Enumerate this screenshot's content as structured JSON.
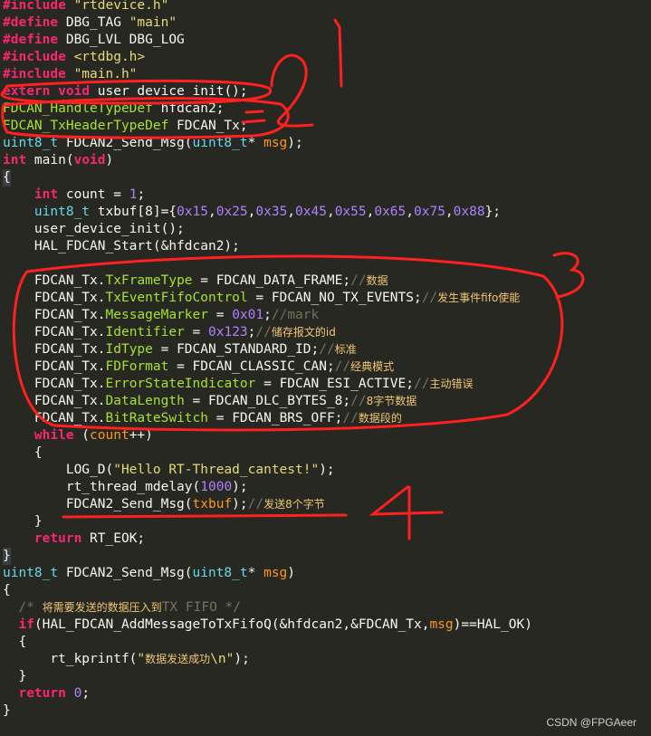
{
  "code_lines": [
    [
      [
        "pp",
        "#include"
      ],
      [
        "pl",
        " "
      ],
      [
        "str",
        "\"rtdevice.h\""
      ]
    ],
    [
      [
        "pp",
        "#define"
      ],
      [
        "pl",
        " DBG_TAG "
      ],
      [
        "str",
        "\"main\""
      ]
    ],
    [
      [
        "pp",
        "#define"
      ],
      [
        "pl",
        " DBG_LVL DBG_LOG"
      ]
    ],
    [
      [
        "pp",
        "#include"
      ],
      [
        "pl",
        " "
      ],
      [
        "str",
        "<rtdbg.h>"
      ]
    ],
    [
      [
        "pp",
        "#include"
      ],
      [
        "pl",
        " "
      ],
      [
        "str",
        "\"main.h\""
      ]
    ],
    [
      [
        "kwb",
        "extern"
      ],
      [
        "pl",
        " "
      ],
      [
        "kwb",
        "void"
      ],
      [
        "pl",
        " user_device_init();"
      ]
    ],
    [
      [
        "typ2",
        "FDCAN_HandleTypeDef"
      ],
      [
        "pl",
        " hfdcan2;"
      ]
    ],
    [
      [
        "typ2",
        "FDCAN_TxHeaderTypeDef"
      ],
      [
        "pl",
        " FDCAN_Tx;"
      ]
    ],
    [
      [
        "type",
        "uint8_t"
      ],
      [
        "pl",
        " FDCAN2_Send_Msg("
      ],
      [
        "type",
        "uint8_t"
      ],
      [
        "pl",
        "* "
      ],
      [
        "var",
        "msg"
      ],
      [
        "pl",
        ");"
      ]
    ],
    [
      [
        "kwb",
        "int"
      ],
      [
        "pl",
        " main("
      ],
      [
        "kwb",
        "void"
      ],
      [
        "pl",
        ")"
      ]
    ],
    [
      [
        "pl",
        "{"
      ]
    ],
    [
      [
        "pl",
        "    "
      ],
      [
        "kwb",
        "int"
      ],
      [
        "pl",
        " count = "
      ],
      [
        "num",
        "1"
      ],
      [
        "pl",
        ";"
      ]
    ],
    [
      [
        "pl",
        "    "
      ],
      [
        "type",
        "uint8_t"
      ],
      [
        "pl",
        " txbuf[8]={"
      ],
      [
        "num",
        "0x15"
      ],
      [
        "pl",
        ","
      ],
      [
        "num",
        "0x25"
      ],
      [
        "pl",
        ","
      ],
      [
        "num",
        "0x35"
      ],
      [
        "pl",
        ","
      ],
      [
        "num",
        "0x45"
      ],
      [
        "pl",
        ","
      ],
      [
        "num",
        "0x55"
      ],
      [
        "pl",
        ","
      ],
      [
        "num",
        "0x65"
      ],
      [
        "pl",
        ","
      ],
      [
        "num",
        "0x75"
      ],
      [
        "pl",
        ","
      ],
      [
        "num",
        "0x88"
      ],
      [
        "pl",
        "};"
      ]
    ],
    [
      [
        "pl",
        "    user_device_init();"
      ]
    ],
    [
      [
        "pl",
        "    HAL_FDCAN_Start(&hfdcan2);"
      ]
    ],
    [
      [
        "pl",
        ""
      ]
    ],
    [
      [
        "pl",
        "    FDCAN_Tx."
      ],
      [
        "fld",
        "TxFrameType"
      ],
      [
        "pl",
        " = FDCAN_DATA_FRAME;"
      ],
      [
        "cm",
        "//"
      ],
      [
        "cmz",
        "数据"
      ]
    ],
    [
      [
        "pl",
        "    FDCAN_Tx."
      ],
      [
        "fld",
        "TxEventFifoControl"
      ],
      [
        "pl",
        " = FDCAN_NO_TX_EVENTS;"
      ],
      [
        "cm",
        "//"
      ],
      [
        "cmz",
        "发生事件fifo使能"
      ]
    ],
    [
      [
        "pl",
        "    FDCAN_Tx."
      ],
      [
        "fld",
        "MessageMarker"
      ],
      [
        "pl",
        " = "
      ],
      [
        "num",
        "0x01"
      ],
      [
        "pl",
        ";"
      ],
      [
        "cm",
        "//mark"
      ]
    ],
    [
      [
        "pl",
        "    FDCAN_Tx."
      ],
      [
        "fld",
        "Identifier"
      ],
      [
        "pl",
        " = "
      ],
      [
        "num",
        "0x123"
      ],
      [
        "pl",
        ";"
      ],
      [
        "cm",
        "//"
      ],
      [
        "cmz",
        "储存报文的id"
      ]
    ],
    [
      [
        "pl",
        "    FDCAN_Tx."
      ],
      [
        "fld",
        "IdType"
      ],
      [
        "pl",
        " = FDCAN_STANDARD_ID;"
      ],
      [
        "cm",
        "//"
      ],
      [
        "cmz",
        "标准"
      ]
    ],
    [
      [
        "pl",
        "    FDCAN_Tx."
      ],
      [
        "fld",
        "FDFormat"
      ],
      [
        "pl",
        " = FDCAN_CLASSIC_CAN;"
      ],
      [
        "cm",
        "//"
      ],
      [
        "cmz",
        "经典模式"
      ]
    ],
    [
      [
        "pl",
        "    FDCAN_Tx."
      ],
      [
        "fld",
        "ErrorStateIndicator"
      ],
      [
        "pl",
        " = FDCAN_ESI_ACTIVE;"
      ],
      [
        "cm",
        "//"
      ],
      [
        "cmz",
        "主动错误"
      ]
    ],
    [
      [
        "pl",
        "    FDCAN_Tx."
      ],
      [
        "fld",
        "DataLength"
      ],
      [
        "pl",
        " = FDCAN_DLC_BYTES_8;"
      ],
      [
        "cm",
        "//"
      ],
      [
        "cmz",
        "8字节数据"
      ]
    ],
    [
      [
        "pl",
        "    FDCAN_Tx."
      ],
      [
        "fld",
        "BitRateSwitch"
      ],
      [
        "pl",
        " = FDCAN_BRS_OFF;"
      ],
      [
        "cm",
        "//"
      ],
      [
        "cmz",
        "数据段的"
      ]
    ],
    [
      [
        "pl",
        "    "
      ],
      [
        "kwb",
        "while"
      ],
      [
        "pl",
        " ("
      ],
      [
        "var",
        "count"
      ],
      [
        "pl",
        "++)"
      ]
    ],
    [
      [
        "pl",
        "    {"
      ]
    ],
    [
      [
        "pl",
        "        LOG_D("
      ],
      [
        "str",
        "\"Hello RT-Thread_cantest!\""
      ],
      [
        "pl",
        ");"
      ]
    ],
    [
      [
        "pl",
        "        rt_thread_mdelay("
      ],
      [
        "num",
        "1000"
      ],
      [
        "pl",
        ");"
      ]
    ],
    [
      [
        "pl",
        "        FDCAN2_Send_Msg("
      ],
      [
        "var",
        "txbuf"
      ],
      [
        "pl",
        ");"
      ],
      [
        "cm",
        "//"
      ],
      [
        "cmz",
        "发送8个字节"
      ]
    ],
    [
      [
        "pl",
        "    }"
      ]
    ],
    [
      [
        "pl",
        "    "
      ],
      [
        "kwb",
        "return"
      ],
      [
        "pl",
        " RT_EOK;"
      ]
    ],
    [
      [
        "pl",
        "}"
      ]
    ],
    [
      [
        "type",
        "uint8_t"
      ],
      [
        "pl",
        " FDCAN2_Send_Msg("
      ],
      [
        "type",
        "uint8_t"
      ],
      [
        "pl",
        "* "
      ],
      [
        "var",
        "msg"
      ],
      [
        "pl",
        ")"
      ]
    ],
    [
      [
        "pl",
        "{"
      ]
    ],
    [
      [
        "pl",
        "  "
      ],
      [
        "cm",
        "/* "
      ],
      [
        "cmz",
        "将需要发送的数据压入到"
      ],
      [
        "cm",
        "TX FIFO */"
      ]
    ],
    [
      [
        "pl",
        "  "
      ],
      [
        "kwb",
        "if"
      ],
      [
        "pl",
        "(HAL_FDCAN_AddMessageToTxFifoQ(&hfdcan2,&FDCAN_Tx,"
      ],
      [
        "var",
        "msg"
      ],
      [
        "pl",
        ")==HAL_OK)"
      ]
    ],
    [
      [
        "pl",
        "  {"
      ]
    ],
    [
      [
        "pl",
        "      rt_kprintf("
      ],
      [
        "str",
        "\""
      ],
      [
        "cmz",
        "数据发送成功"
      ],
      [
        "str",
        "\\n\""
      ],
      [
        "pl",
        ");"
      ]
    ],
    [
      [
        "pl",
        "  }"
      ]
    ],
    [
      [
        "pl",
        "  "
      ],
      [
        "kwb",
        "return"
      ],
      [
        "pl",
        " "
      ],
      [
        "num",
        "0"
      ],
      [
        "pl",
        ";"
      ]
    ],
    [
      [
        "pl",
        "}"
      ]
    ]
  ],
  "watermark": "CSDN @FPGAeer",
  "annotations": [
    "1",
    "2",
    "3",
    "4"
  ]
}
